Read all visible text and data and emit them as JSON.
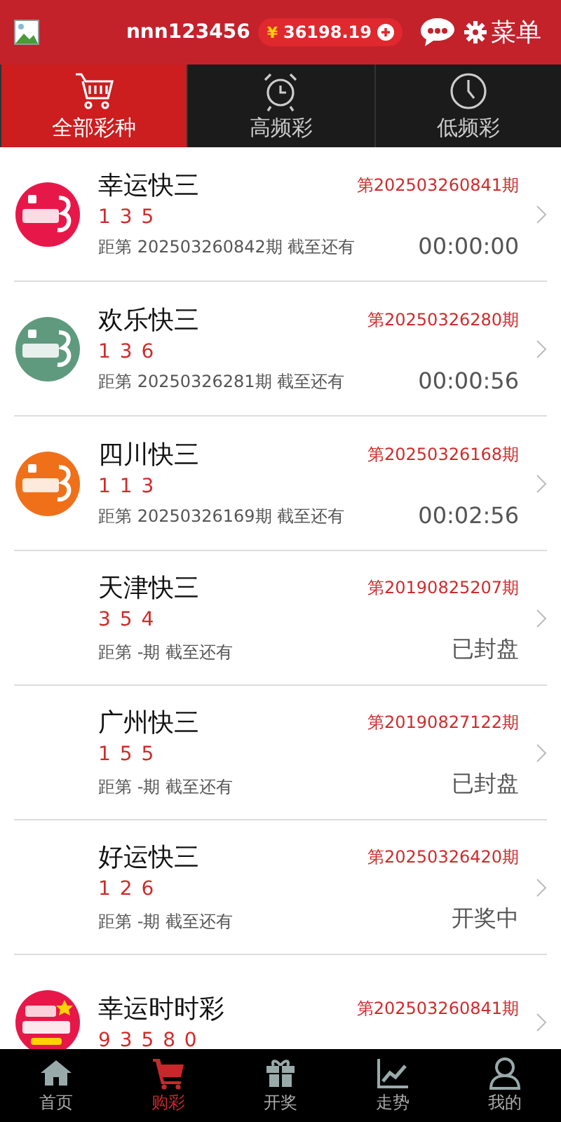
{
  "header": {
    "username": "nnn123456",
    "currency": "¥",
    "balance": "36198.19",
    "menu_label": "菜单"
  },
  "tabs": [
    {
      "label": "全部彩种",
      "kind": "cart",
      "selected": true
    },
    {
      "label": "高频彩",
      "kind": "alarm",
      "selected": false
    },
    {
      "label": "低频彩",
      "kind": "clock",
      "selected": false
    }
  ],
  "lotteries": [
    {
      "name": "幸运快三",
      "issue": "第202503260841期",
      "numbers": "1 3 5",
      "next": "距第 202503260842期 截至还有",
      "countdown": "00:00:00",
      "kind": "k3",
      "color": "#e8174a"
    },
    {
      "name": "欢乐快三",
      "issue": "第20250326280期",
      "numbers": "1 3 6",
      "next": "距第 20250326281期 截至还有",
      "countdown": "00:00:56",
      "kind": "k3",
      "color": "#5f9a7e"
    },
    {
      "name": "四川快三",
      "issue": "第20250326168期",
      "numbers": "1 1 3",
      "next": "距第 20250326169期 截至还有",
      "countdown": "00:02:56",
      "kind": "k3",
      "color": "#f0701a"
    },
    {
      "name": "天津快三",
      "issue": "第20190825207期",
      "numbers": "3 5 4",
      "next": "距第 -期 截至还有",
      "countdown": "已封盘",
      "kind": "plain"
    },
    {
      "name": "广州快三",
      "issue": "第20190827122期",
      "numbers": "1 5 5",
      "next": "距第 -期 截至还有",
      "countdown": "已封盘",
      "kind": "plain"
    },
    {
      "name": "好运快三",
      "issue": "第20250326420期",
      "numbers": "1 2 6",
      "next": "距第 -期 截至还有",
      "countdown": "开奖中",
      "kind": "plain"
    },
    {
      "name": "幸运时时彩",
      "issue": "第202503260841期",
      "numbers": "9 3 5 8 0",
      "kind": "ssc",
      "color": "#e8174a"
    }
  ],
  "bottom_nav": [
    {
      "label": "首页",
      "kind": "home",
      "selected": false
    },
    {
      "label": "购彩",
      "kind": "cart",
      "selected": true
    },
    {
      "label": "开奖",
      "kind": "gift",
      "selected": false
    },
    {
      "label": "走势",
      "kind": "trend",
      "selected": false
    },
    {
      "label": "我的",
      "kind": "user",
      "selected": false
    }
  ]
}
